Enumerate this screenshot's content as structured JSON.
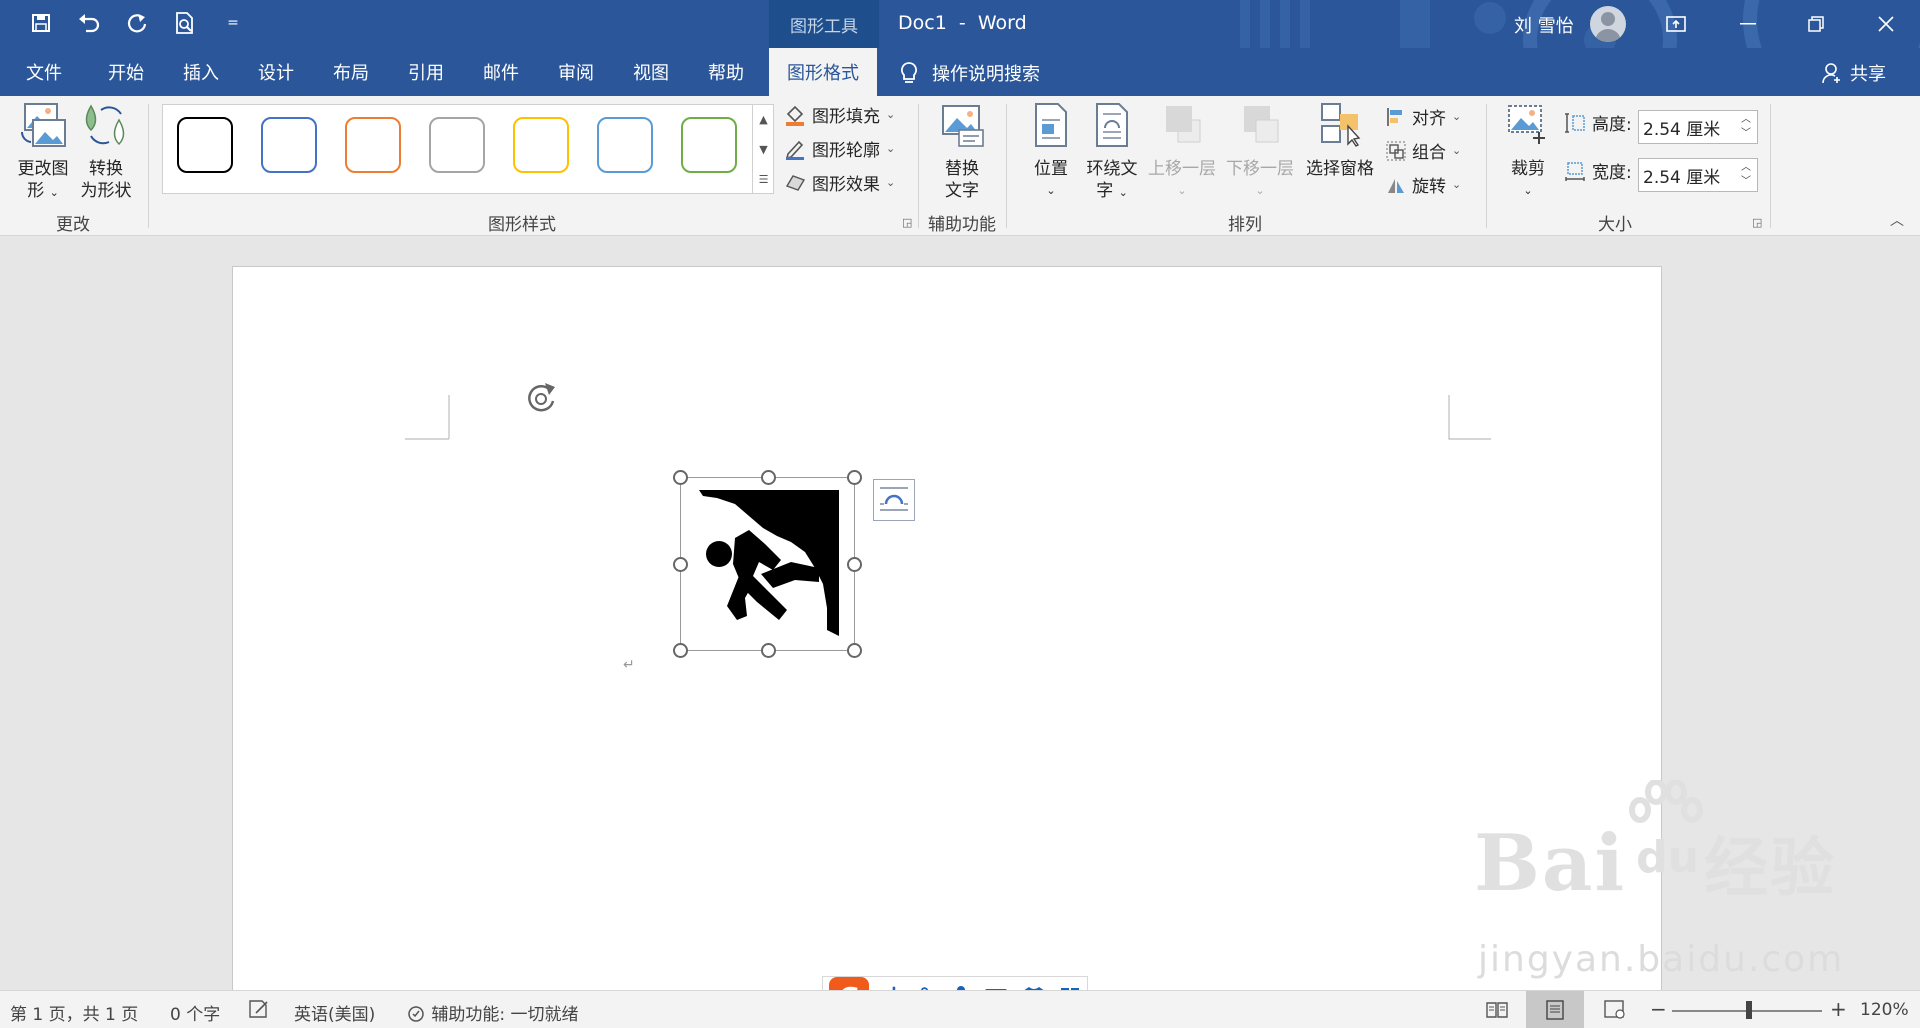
{
  "titlebar": {
    "context_tool": "图形工具",
    "doc_name": "Doc1",
    "app_name": "Word",
    "user_name": "刘 雪怡",
    "qat_overflow": "="
  },
  "tabs": [
    {
      "label": "文件"
    },
    {
      "label": "开始"
    },
    {
      "label": "插入"
    },
    {
      "label": "设计"
    },
    {
      "label": "布局"
    },
    {
      "label": "引用"
    },
    {
      "label": "邮件"
    },
    {
      "label": "审阅"
    },
    {
      "label": "视图"
    },
    {
      "label": "帮助"
    },
    {
      "label": "图形格式",
      "active": true
    }
  ],
  "tell_me": "操作说明搜索",
  "share": "共享",
  "ribbon": {
    "change_group": {
      "label": "更改",
      "change_graphic": "更改图",
      "change_graphic_2": "形",
      "convert_shape": "转换",
      "convert_shape_2": "为形状"
    },
    "styles_group": {
      "label": "图形样式",
      "swatch_colors": [
        "#000000",
        "#4472c4",
        "#ed7d31",
        "#a5a5a5",
        "#ffc000",
        "#5b9bd5",
        "#70ad47"
      ],
      "fill": "图形填充",
      "outline": "图形轮廓",
      "effects": "图形效果"
    },
    "accessibility_group": {
      "label": "辅助功能",
      "alt_text": "替换",
      "alt_text_2": "文字"
    },
    "arrange_group": {
      "label": "排列",
      "position": "位置",
      "wrap": "环绕文",
      "wrap_2": "字",
      "bring_forward": "上移一层",
      "send_backward": "下移一层",
      "selection_pane": "选择窗格",
      "align": "对齐",
      "group": "组合",
      "rotate": "旋转"
    },
    "size_group": {
      "label": "大小",
      "crop": "裁剪",
      "height_label": "高度:",
      "height_value": "2.54 厘米",
      "width_label": "宽度:",
      "width_value": "2.54 厘米"
    }
  },
  "statusbar": {
    "page": "第 1 页，共 1 页",
    "words": "0 个字",
    "language": "英语(美国)",
    "accessibility": "辅助功能: 一切就绪",
    "zoom": "120%"
  },
  "ime": {
    "logo": "S",
    "mode": "中",
    "punct": "°,"
  },
  "watermark": {
    "brand": "Bai",
    "brand_du": "du",
    "brand_cn": "经验",
    "url": "jingyan.baidu.com"
  },
  "colors": {
    "titlebar": "#2b579a",
    "ribbon": "#f3f3f3",
    "accent": "#2b579a"
  }
}
